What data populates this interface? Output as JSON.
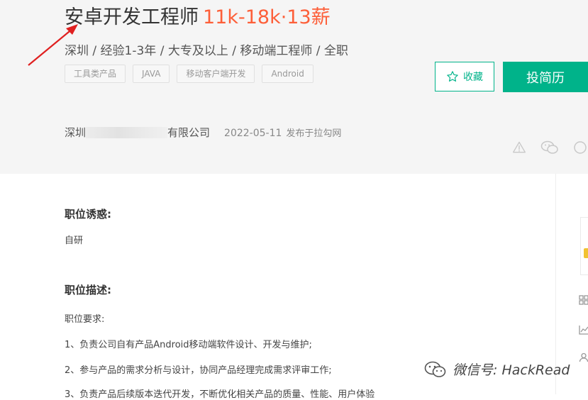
{
  "job": {
    "title": "安卓开发工程师",
    "salary": "11k-18k·13薪",
    "meta": "深圳 / 经验1-3年 / 大专及以上 / 移动端工程师 / 全职",
    "tags": [
      "工具类产品",
      "JAVA",
      "移动客户端开发",
      "Android"
    ]
  },
  "actions": {
    "collect_label": "收藏",
    "apply_label": "投简历"
  },
  "company": {
    "prefix": "深圳",
    "suffix": "有限公司",
    "date": "2022-05-11",
    "published": "发布于拉勾网"
  },
  "sections": {
    "perks_title": "职位诱惑:",
    "perks_text": "自研",
    "desc_title": "职位描述:",
    "requirements_heading": "职位要求:",
    "req1": "1、负责公司自有产品Android移动端软件设计、开发与维护;",
    "req2": "2、参与产品的需求分析与设计，协同产品经理完成需求评审工作;",
    "req3": "3、负责产品后续版本迭代开发，不断优化相关产品的质量、性能、用户体验"
  },
  "watermark": {
    "text": "微信号: HackRead"
  },
  "colors": {
    "accent": "#00b38a",
    "salary": "#fd5f39",
    "arrow": "#e02020"
  },
  "icons": [
    "star-icon",
    "warning-icon",
    "wechat-icon",
    "weibo-icon",
    "wechat-logo-icon"
  ]
}
